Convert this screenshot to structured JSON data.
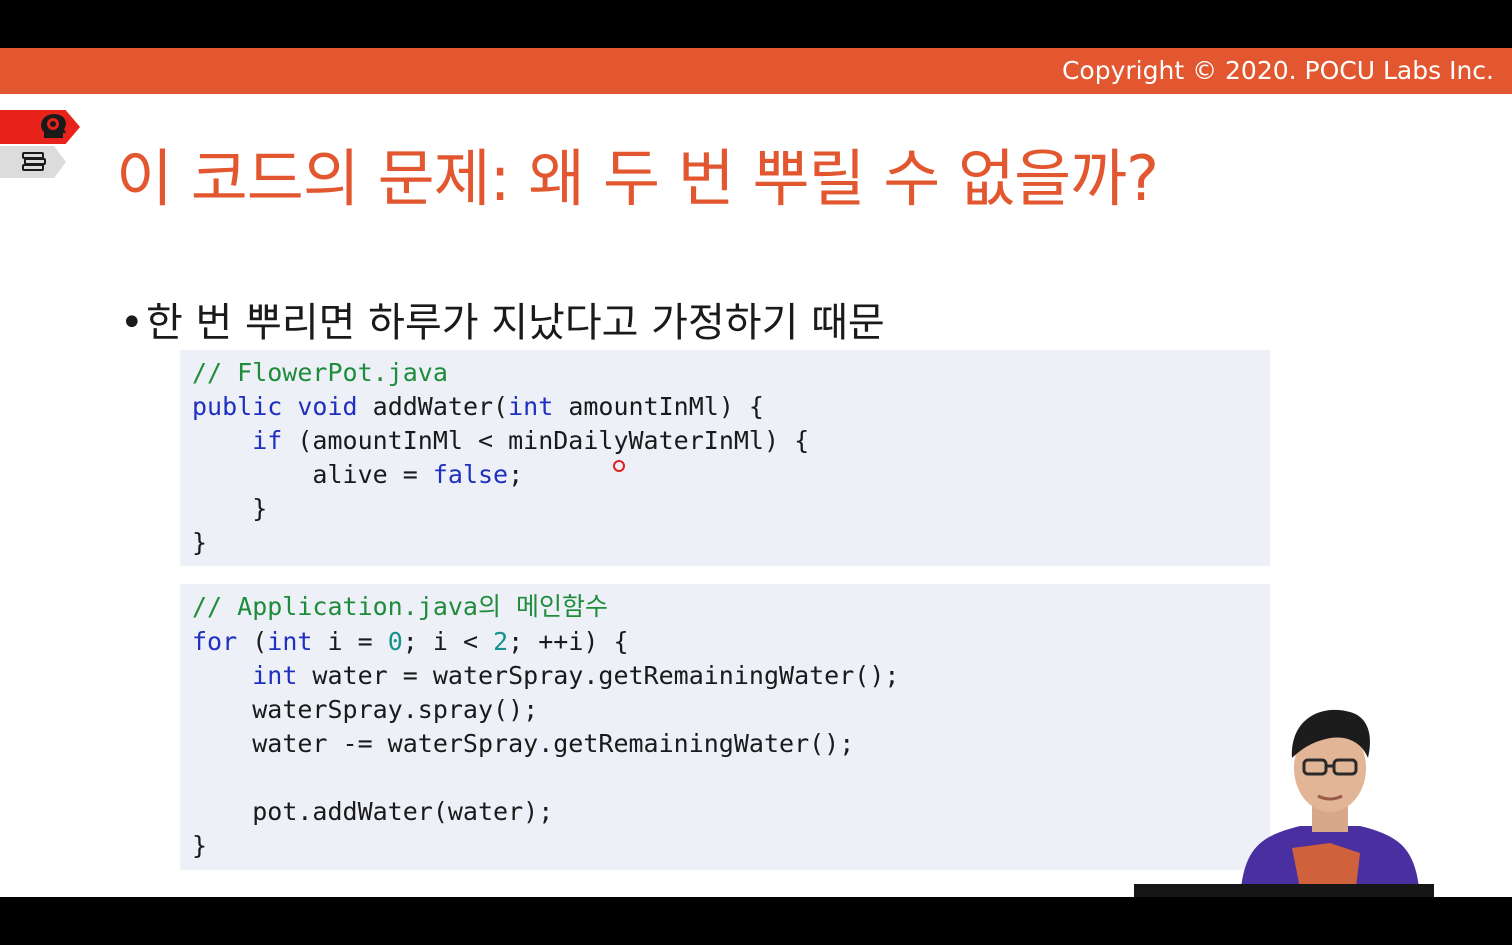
{
  "header": {
    "copyright": "Copyright © 2020. POCU Labs Inc.",
    "accent_color": "#e2572f"
  },
  "side_tags": {
    "top_icon": "brain-head-icon",
    "bottom_icon": "book-stack-icon"
  },
  "slide": {
    "title": "이 코드의 문제: 왜 두 번 뿌릴 수 없을까?",
    "bullet": "한 번 뿌리면 하루가 지났다고 가정하기 때문"
  },
  "code1": {
    "comment": "// FlowerPot.java",
    "line2_kw1": "public",
    "line2_kw2": "void",
    "line2_mid": " addWater(",
    "line2_kw3": "int",
    "line2_end": " amountInMl) {",
    "line3_kw": "if",
    "line3_end": " (amountInMl < minDailyWaterInMl) {",
    "line4_start": "alive = ",
    "line4_kw": "false",
    "line4_end": ";",
    "line5": "}",
    "line6": "}"
  },
  "code2": {
    "comment": "// Application.java의 메인함수",
    "line2_kw": "for",
    "line2_a": " (",
    "line2_kw2": "int",
    "line2_b": " i = ",
    "line2_num1": "0",
    "line2_c": "; i < ",
    "line2_num2": "2",
    "line2_d": "; ++i) {",
    "line3_kw": "int",
    "line3_end": " water = waterSpray.getRemainingWater();",
    "line4": "waterSpray.spray();",
    "line5": "water -= waterSpray.getRemainingWater();",
    "line6": "pot.addWater(water);",
    "line7": "}"
  },
  "colors": {
    "keyword": "#1f2fbf",
    "comment": "#1e8c3a",
    "number": "#16918c",
    "code_bg": "#eef0f8"
  }
}
